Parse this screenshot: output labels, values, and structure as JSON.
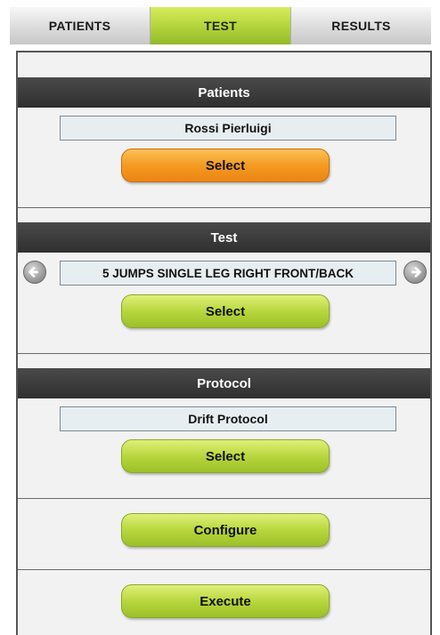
{
  "tabs": [
    {
      "label": "PATIENTS",
      "active": false
    },
    {
      "label": "TEST",
      "active": true
    },
    {
      "label": "RESULTS",
      "active": false
    }
  ],
  "patients": {
    "header": "Patients",
    "value": "Rossi Pierluigi",
    "select_label": "Select"
  },
  "test": {
    "header": "Test",
    "value": "5 JUMPS SINGLE LEG RIGHT FRONT/BACK",
    "select_label": "Select"
  },
  "protocol": {
    "header": "Protocol",
    "value": "Drift Protocol",
    "select_label": "Select"
  },
  "actions": {
    "configure_label": "Configure",
    "execute_label": "Execute"
  },
  "colors": {
    "accent_green": "#b2d23a",
    "accent_orange": "#f49a22",
    "header_dark": "#333333"
  },
  "icons": {
    "prev": "arrow-left-circle-icon",
    "next": "arrow-right-circle-icon"
  }
}
